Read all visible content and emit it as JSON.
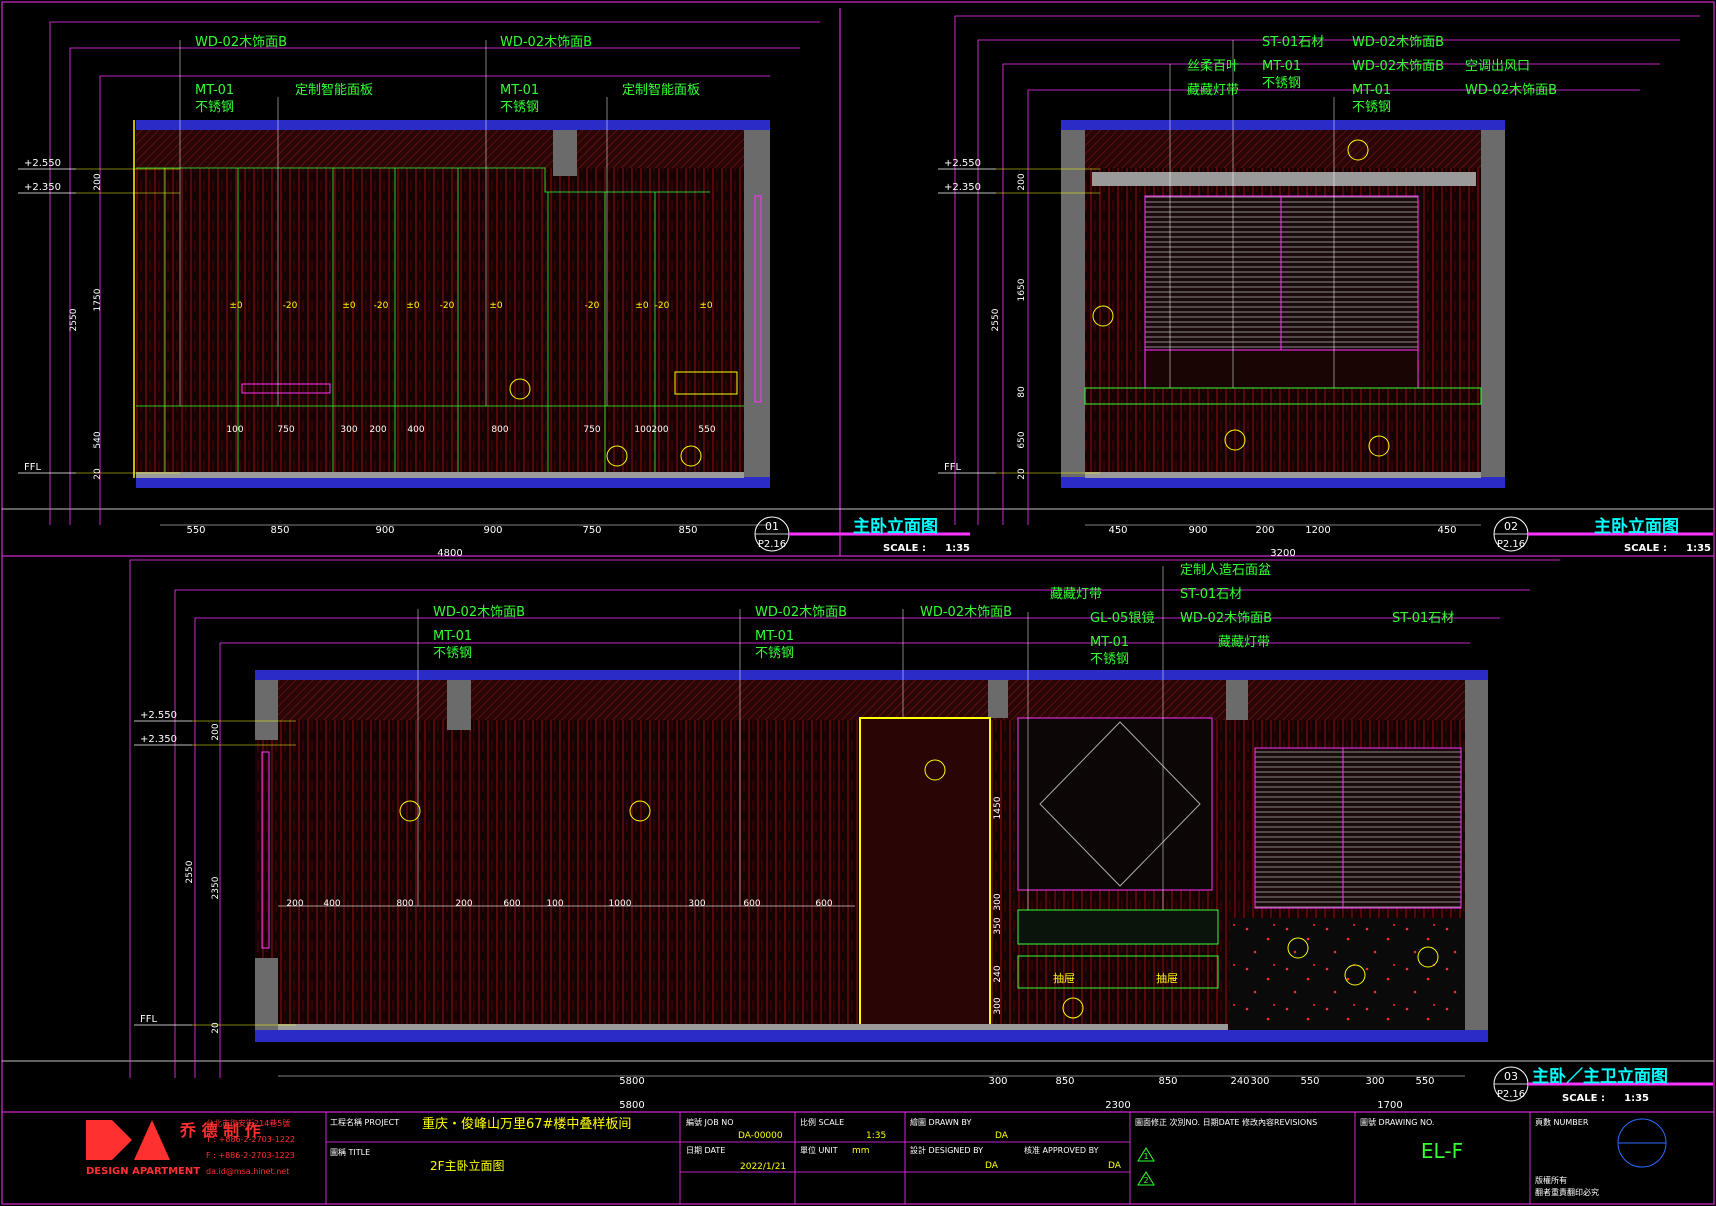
{
  "elevations": [
    {
      "number": "01",
      "sheet": "P2.16",
      "title": "主卧立面图",
      "scale_label": "SCALE :",
      "scale": "1:35",
      "levels": [
        "+2.550",
        "+2.350",
        "FFL"
      ],
      "materials": [
        {
          "code": "WD-02木饰面B"
        },
        {
          "code": "MT-01",
          "name": "不锈钢"
        },
        {
          "code": "定制智能面板"
        },
        {
          "code": "WD-02木饰面B"
        },
        {
          "code": "MT-01",
          "name": "不锈钢"
        },
        {
          "code": "定制智能面板"
        }
      ],
      "bottom_dims": [
        "550",
        "850",
        "900",
        "900",
        "750",
        "850"
      ],
      "total_dim": "4800",
      "vertical_dims": [
        "2550",
        "1750",
        "200",
        "540",
        "20"
      ],
      "panel_dims": [
        "±0",
        "-20",
        "±0",
        "-20",
        "±0",
        "-20",
        "±0",
        "-20",
        "±0",
        "-20",
        "±0"
      ],
      "inner_dims": [
        "100",
        "750",
        "300",
        "200",
        "400",
        "800",
        "750",
        "100",
        "200",
        "550"
      ]
    },
    {
      "number": "02",
      "sheet": "P2.16",
      "title": "主卧立面图",
      "scale_label": "SCALE :",
      "scale": "1:35",
      "levels": [
        "+2.550",
        "+2.350",
        "FFL"
      ],
      "materials": [
        {
          "code": "丝柔百叶"
        },
        {
          "code": "藏藏灯带"
        },
        {
          "code": "ST-01石材"
        },
        {
          "code": "MT-01",
          "name": "不锈钢"
        },
        {
          "code": "WD-02木饰面B"
        },
        {
          "code": "WD-02木饰面B"
        },
        {
          "code": "MT-01",
          "name": "不锈钢"
        },
        {
          "code": "空调出风口"
        },
        {
          "code": "WD-02木饰面B"
        }
      ],
      "bottom_dims": [
        "450",
        "900",
        "200",
        "1200",
        "450"
      ],
      "total_dim": "3200",
      "vertical_dims": [
        "2550",
        "1650",
        "200",
        "80",
        "650",
        "20"
      ]
    },
    {
      "number": "03",
      "sheet": "P2.16",
      "title": "主卧／主卫立面图",
      "scale_label": "SCALE :",
      "scale": "1:35",
      "levels": [
        "+2.550",
        "+2.350",
        "FFL"
      ],
      "materials": [
        {
          "code": "WD-02木饰面B"
        },
        {
          "code": "MT-01",
          "name": "不锈钢"
        },
        {
          "code": "WD-02木饰面B"
        },
        {
          "code": "MT-01",
          "name": "不锈钢"
        },
        {
          "code": "WD-02木饰面B"
        },
        {
          "code": "藏藏灯带"
        },
        {
          "code": "GL-05银镜"
        },
        {
          "code": "MT-01",
          "name": "不锈钢"
        },
        {
          "code": "定制人造石面盆"
        },
        {
          "code": "ST-01石材"
        },
        {
          "code": "WD-02木饰面B"
        },
        {
          "code": "藏藏灯带"
        },
        {
          "code": "ST-01石材"
        }
      ],
      "bottom_dims": [
        "5800",
        "300",
        "850",
        "850",
        "240",
        "300",
        "550",
        "300",
        "550"
      ],
      "total_dims": [
        "5800",
        "2300",
        "1700"
      ],
      "vertical_dims": [
        "2550",
        "2350",
        "200",
        "1450",
        "300",
        "350",
        "240",
        "300",
        "20"
      ],
      "inner_dims": [
        "200",
        "400",
        "800",
        "200",
        "600",
        "100",
        "1000",
        "300",
        "600",
        "600"
      ],
      "drawer_labels": [
        "抽屉",
        "抽屉"
      ]
    }
  ],
  "title_block": {
    "company_cn": "乔 德 制 作",
    "company_en": "DESIGN APARTMENT",
    "address": "台北市復安街214巷5號",
    "tel": "T : +886-2-2703-1222",
    "fax": "F : +886-2-2703-1223",
    "email": "da.id@msa.hinet.net",
    "project_label": "工程名稱 PROJECT",
    "project": "重庆・俊峰山万里67#楼中叠样板间",
    "drawing_title_label": "圖稱 TITLE",
    "drawing_title": "2F主卧立面图",
    "job_no_label": "編號 JOB NO",
    "job_no": "DA-00000",
    "date_label": "日期 DATE",
    "date": "2022/1/21",
    "scale_label": "比例 SCALE",
    "scale": "1:35",
    "unit_label": "單位 UNIT",
    "unit": "mm",
    "drawn_by_label": "繪圖 DRAWN BY",
    "drawn_by": "DA",
    "designed_by_label": "設計 DESIGNED BY",
    "designed_by": "DA",
    "approved_by_label": "核准 APPROVED BY",
    "approved_by": "DA",
    "revisions_label": "圖面修正 次別NO. 日期DATE 修改內容REVISIONS",
    "revision_marks": [
      "1",
      "2"
    ],
    "drawing_no_label": "圖號 DRAWING NO.",
    "drawing_no": "EL-F",
    "page_no_label": "頁數 NUMBER",
    "copyright_1": "版權所有",
    "copyright_2": "翻者重責翻印必究"
  },
  "colors": {
    "background": "#000000",
    "frame": "#ff33ff",
    "text_green": "#33ff33",
    "yellow": "#ffff00",
    "wall_gray": "#6b6b6b",
    "wall_blue": "#2b2bc8",
    "wood_red": "#7a1010",
    "cyan": "#00ffff"
  }
}
